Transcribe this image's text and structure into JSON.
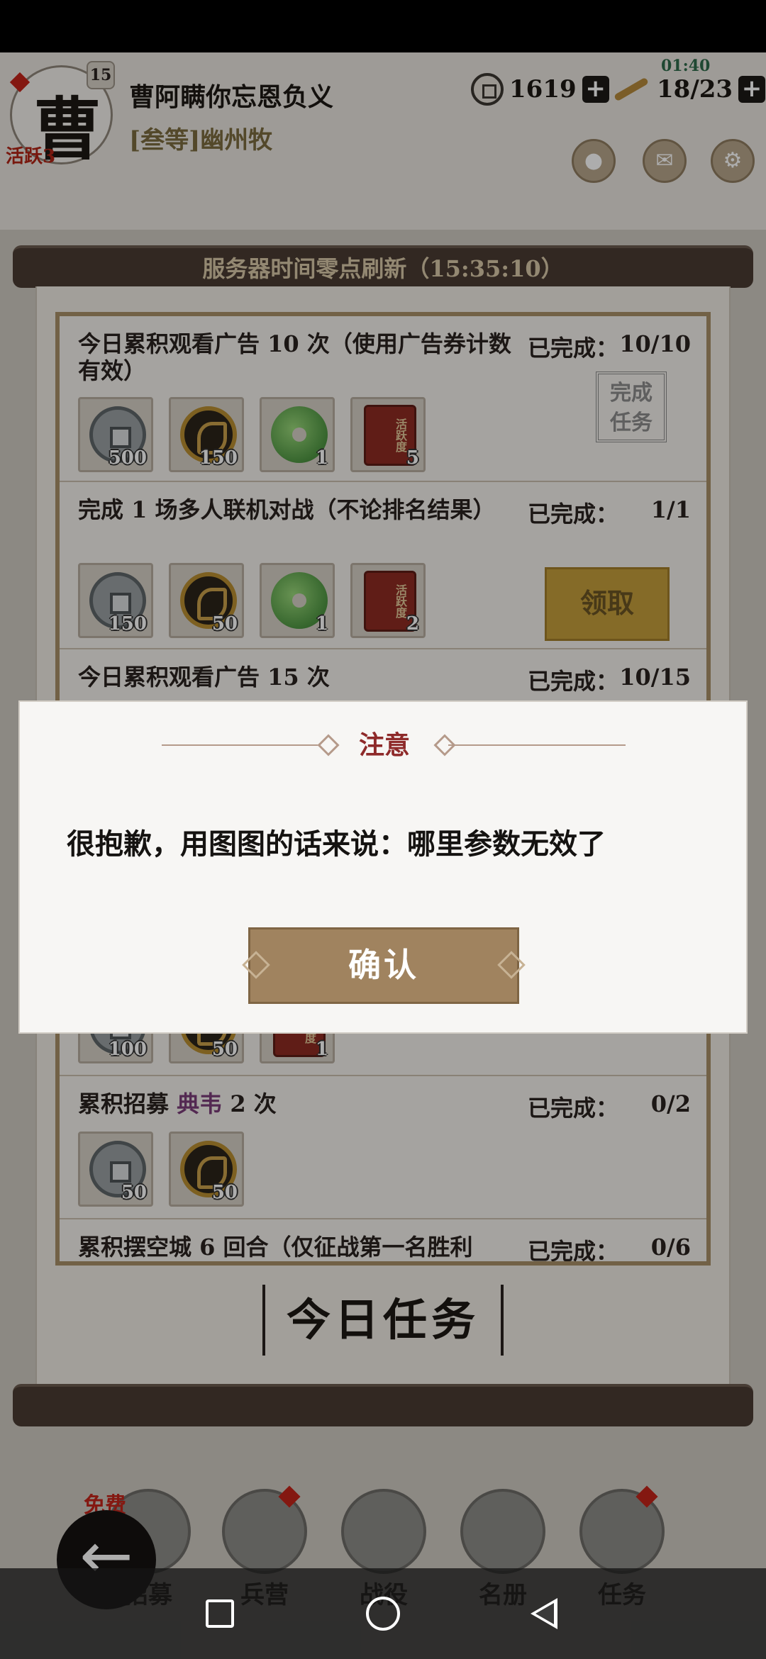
{
  "header": {
    "avatar_char": "曹",
    "level": "15",
    "activity_tag": "活跃3",
    "player_name": "曹阿瞒你忘恩负义",
    "player_title": "[叁等]幽州牧",
    "coins": "1619",
    "grain": "18/23",
    "grain_timer": "01:40"
  },
  "panel": {
    "refresh_text": "服务器时间零点刷新（15:35:10）",
    "section_title": "今日任务"
  },
  "tasks": [
    {
      "desc": "今日累积观看广告 10 次（使用广告券计数有效）",
      "progress_label": "已完成：",
      "count": "10/10",
      "rewards": [
        "500",
        "150",
        "1",
        "5"
      ],
      "status": "完成任务"
    },
    {
      "desc": "完成 1 场多人联机对战（不论排名结果）",
      "progress_label": "已完成：",
      "count": "1/1",
      "rewards": [
        "150",
        "50",
        "1",
        "2"
      ],
      "status": "领取"
    },
    {
      "desc": "今日累积观看广告 15 次",
      "progress_label": "已完成：",
      "count": "10/15",
      "rewards": [
        "100",
        "50",
        "1"
      ]
    },
    {
      "desc_pre": "累积招募 ",
      "desc_hl": "典韦",
      "desc_post": " 2 次",
      "progress_label": "已完成：",
      "count": "0/2",
      "rewards": [
        "50",
        "50"
      ]
    },
    {
      "desc": "累积摆空城 6 回合（仅征战第一名胜利",
      "progress_label": "已完成：",
      "count": "0/6"
    }
  ],
  "bottom_nav": {
    "free_tag": "免费",
    "items": [
      "招募",
      "兵营",
      "战役",
      "名册",
      "任务"
    ]
  },
  "dialog": {
    "title": "注意",
    "message": "很抱歉，用图图的话来说：哪里参数无效了",
    "confirm_label": "确认"
  }
}
